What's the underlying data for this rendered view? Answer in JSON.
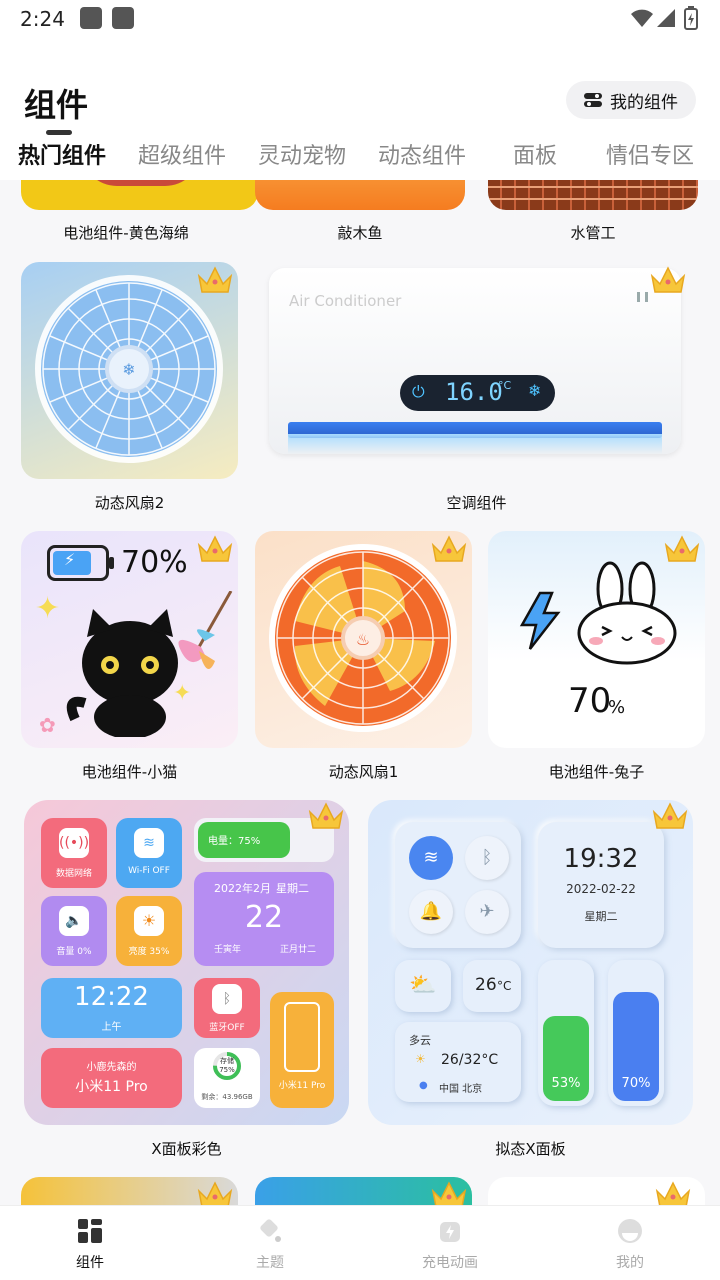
{
  "status": {
    "time": "2:24"
  },
  "header": {
    "title": "组件",
    "my_widgets": "我的组件"
  },
  "tabs": [
    "热门组件",
    "超级组件",
    "灵动宠物",
    "动态组件",
    "面板",
    "情侣专区"
  ],
  "row1": [
    "电池组件-黄色海绵",
    "敲木鱼",
    "水管工"
  ],
  "fan2": {
    "label": "动态风扇2"
  },
  "aircon": {
    "label": "空调组件",
    "brand": "Air Conditioner",
    "temp": "16.0",
    "unit": "°C"
  },
  "cat": {
    "label": "电池组件-小猫",
    "percent": "70%"
  },
  "fan1": {
    "label": "动态风扇1"
  },
  "rabbit": {
    "label": "电池组件-兔子",
    "percent": "70",
    "unit": "%"
  },
  "xpanel": {
    "label": "X面板彩色",
    "data_net": "数据网络",
    "wifi": "Wi-Fi OFF",
    "battery": "电量：75%",
    "volume": "音量 0%",
    "brightness": "亮度 35%",
    "date_top": "2022年2月",
    "weekday": "星期二",
    "day": "22",
    "lunar_year": "壬寅年",
    "lunar_day": "正月廿二",
    "time": "12:22",
    "ampm": "上午",
    "bt": "蓝牙OFF",
    "storage_title": "存储",
    "storage_pct": "75%",
    "storage_left": "剩余：43.96GB",
    "owner": "小鹿先森的",
    "device": "小米11 Pro",
    "phone": "小米11 Pro"
  },
  "skeu": {
    "label": "拟态X面板",
    "time": "19:32",
    "date": "2022-02-22",
    "weekday": "星期二",
    "temp": "26",
    "temp_unit": "°C",
    "weather": "多云",
    "range": "26/32°C",
    "location": "中国 北京",
    "pct1": "53%",
    "pct2": "70%"
  },
  "nav": [
    "组件",
    "主题",
    "充电动画",
    "我的"
  ],
  "colors": {
    "accent": "#111111",
    "green": "#4cd05a",
    "blue": "#4a7ff0"
  }
}
